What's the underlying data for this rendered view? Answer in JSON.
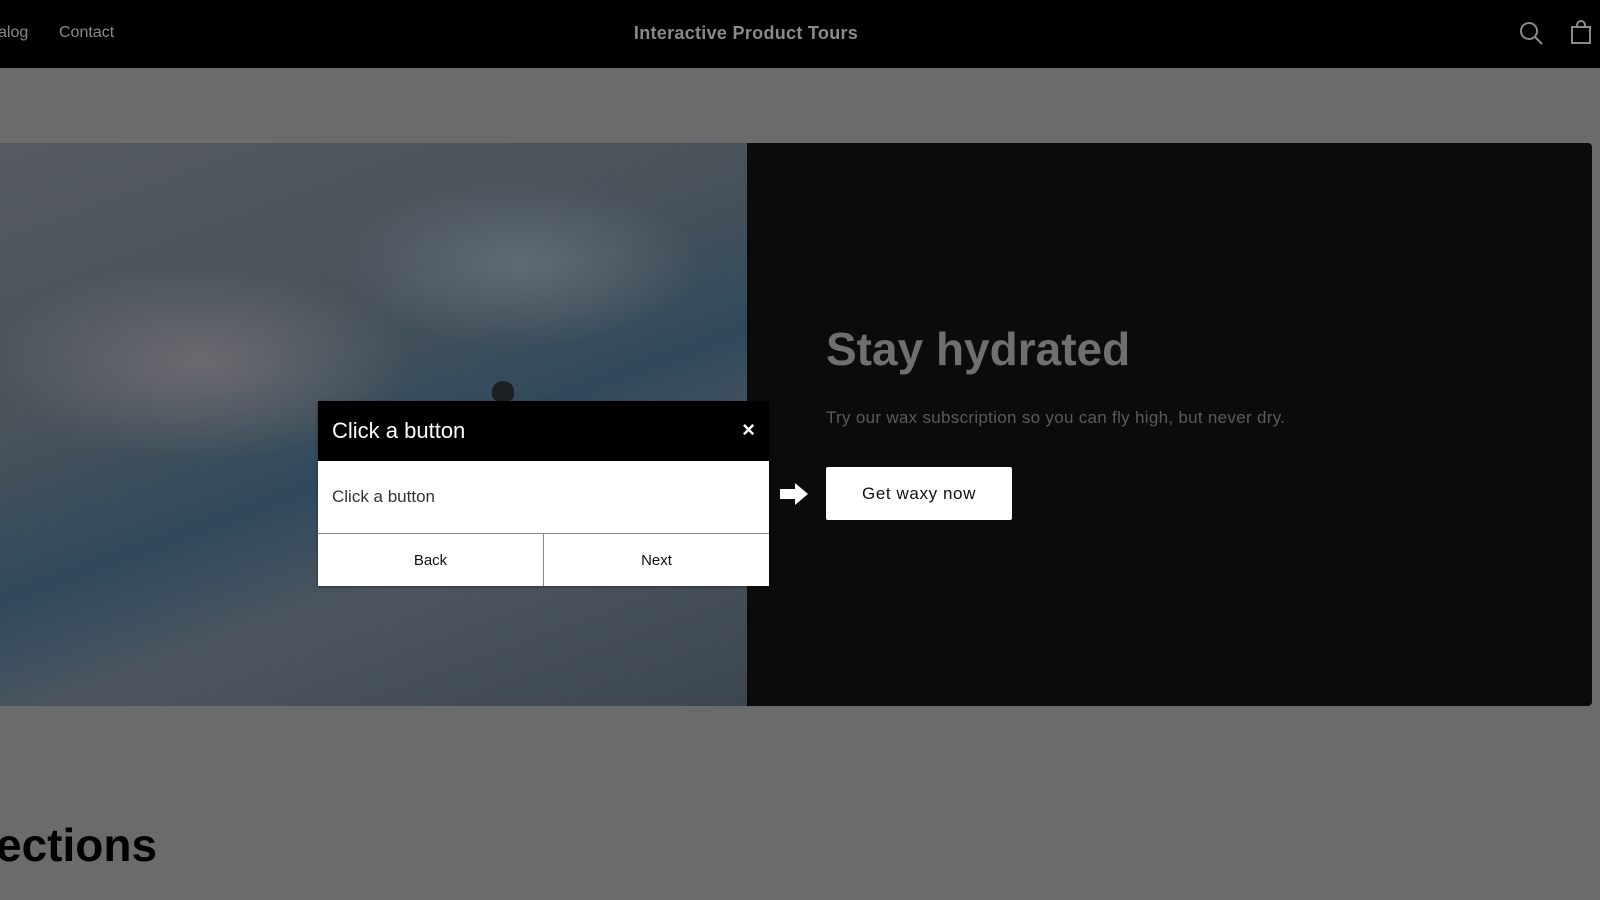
{
  "nav": {
    "links": [
      "alog",
      "Contact"
    ],
    "brand": "Interactive Product Tours"
  },
  "hero": {
    "title": "Stay hydrated",
    "subtitle": "Try our wax subscription so you can fly high, but never dry.",
    "cta": "Get waxy now"
  },
  "tour": {
    "title": "Click a button",
    "close": "×",
    "body": "Click a button",
    "back": "Back",
    "next": "Next"
  },
  "section": {
    "heading": "ections"
  }
}
